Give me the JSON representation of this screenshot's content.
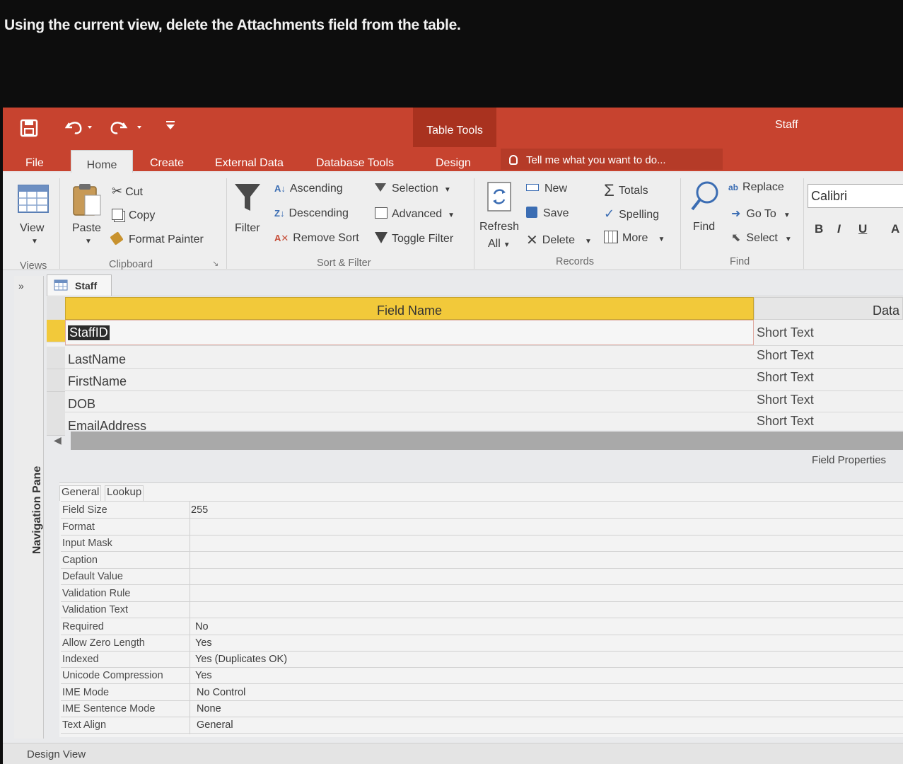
{
  "question": "Using the current view, delete the Attachments field from the table.",
  "title_bar": {
    "contextual_label": "Table Tools",
    "window_title": "Staff"
  },
  "tabs": [
    "File",
    "Home",
    "Create",
    "External Data",
    "Database Tools",
    "Design"
  ],
  "tell_me": "Tell me what you want to do...",
  "ribbon": {
    "views": {
      "view_label": "View",
      "group": "Views"
    },
    "clipboard": {
      "paste": "Paste",
      "cut": "Cut",
      "copy": "Copy",
      "format_painter": "Format Painter",
      "group": "Clipboard"
    },
    "sort_filter": {
      "filter": "Filter",
      "ascending": "Ascending",
      "descending": "Descending",
      "remove_sort": "Remove Sort",
      "selection": "Selection",
      "advanced": "Advanced",
      "toggle_filter": "Toggle Filter",
      "group": "Sort & Filter"
    },
    "records": {
      "refresh": "Refresh",
      "refresh_all": "All",
      "new": "New",
      "save": "Save",
      "delete": "Delete",
      "totals": "Totals",
      "spelling": "Spelling",
      "more": "More",
      "group": "Records"
    },
    "find": {
      "find": "Find",
      "replace": "Replace",
      "goto": "Go To",
      "select": "Select",
      "group": "Find"
    },
    "text": {
      "font": "Calibri",
      "bold": "B",
      "italic": "I",
      "underline": "U",
      "extra": "A"
    }
  },
  "document_tab": "Staff",
  "navigation_pane": "Navigation Pane",
  "grid": {
    "headers": {
      "field_name": "Field Name",
      "data_type": "Data"
    },
    "rows": [
      {
        "name": "StaffID",
        "type": "Short Text"
      },
      {
        "name": "LastName",
        "type": "Short Text"
      },
      {
        "name": "FirstName",
        "type": "Short Text"
      },
      {
        "name": "DOB",
        "type": "Short Text"
      },
      {
        "name": "EmailAddress",
        "type": "Short Text"
      }
    ]
  },
  "field_properties": {
    "title": "Field Properties",
    "tabs": [
      "General",
      "Lookup"
    ],
    "rows": [
      {
        "label": "Field Size",
        "value": "255"
      },
      {
        "label": "Format",
        "value": ""
      },
      {
        "label": "Input Mask",
        "value": ""
      },
      {
        "label": "Caption",
        "value": ""
      },
      {
        "label": "Default Value",
        "value": ""
      },
      {
        "label": "Validation Rule",
        "value": ""
      },
      {
        "label": "Validation Text",
        "value": ""
      },
      {
        "label": "Required",
        "value": "No"
      },
      {
        "label": "Allow Zero Length",
        "value": "Yes"
      },
      {
        "label": "Indexed",
        "value": "Yes (Duplicates OK)"
      },
      {
        "label": "Unicode Compression",
        "value": "Yes"
      },
      {
        "label": "IME Mode",
        "value": "No Control"
      },
      {
        "label": "IME Sentence Mode",
        "value": "None"
      },
      {
        "label": "Text Align",
        "value": "General"
      }
    ]
  },
  "status": "Design View"
}
